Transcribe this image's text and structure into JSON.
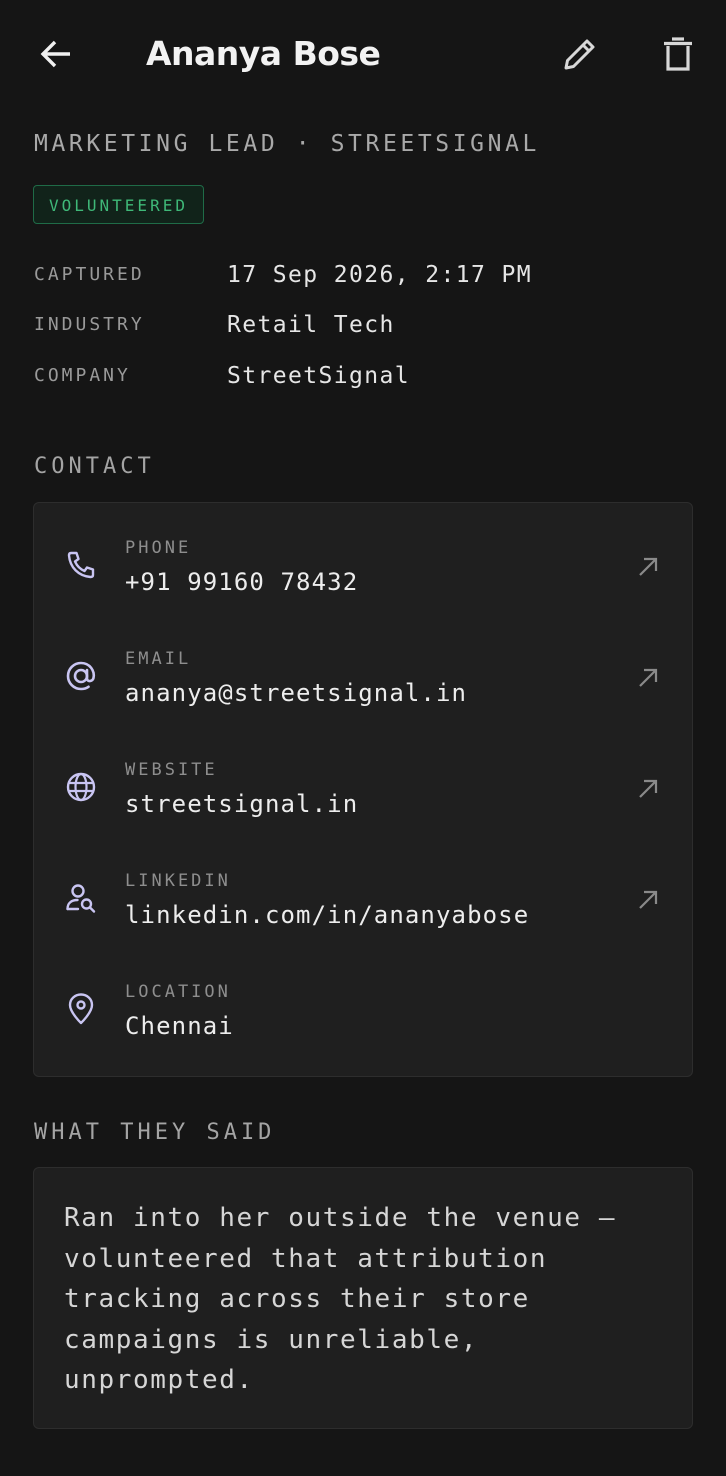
{
  "header": {
    "title": "Ananya Bose",
    "back_icon": "arrow-left-icon",
    "edit_icon": "pencil-icon",
    "delete_icon": "trash-icon"
  },
  "lead": {
    "subtitle": "MARKETING LEAD · STREETSIGNAL",
    "status_badge": "VOLUNTEERED",
    "status_color": "#3fb878"
  },
  "meta": [
    {
      "label": "CAPTURED",
      "value": "17 Sep 2026, 2:17 PM"
    },
    {
      "label": "INDUSTRY",
      "value": "Retail Tech"
    },
    {
      "label": "COMPANY",
      "value": "StreetSignal"
    }
  ],
  "contact": {
    "section_label": "CONTACT",
    "items": [
      {
        "label": "PHONE",
        "value": "+91 99160 78432",
        "icon": "phone-icon",
        "action_icon": "external-arrow-icon"
      },
      {
        "label": "EMAIL",
        "value": "ananya@streetsignal.in",
        "icon": "at-sign-icon",
        "action_icon": "external-arrow-icon"
      },
      {
        "label": "WEBSITE",
        "value": "streetsignal.in",
        "icon": "globe-icon",
        "action_icon": "external-arrow-icon"
      },
      {
        "label": "LINKEDIN",
        "value": "linkedin.com/in/ananyabose",
        "icon": "user-search-icon",
        "action_icon": "external-arrow-icon"
      },
      {
        "label": "LOCATION",
        "value": "Chennai",
        "icon": "map-pin-icon"
      }
    ]
  },
  "notes": {
    "section_label": "WHAT THEY SAID",
    "text": "Ran into her outside the venue —\nvolunteered that attribution\ntracking across their store\ncampaigns is unreliable,\nunprompted."
  },
  "colors": {
    "background": "#151515",
    "card": "#1f1f1f",
    "icon_accent": "#c9c5f2",
    "badge_border": "#1f6b47"
  }
}
